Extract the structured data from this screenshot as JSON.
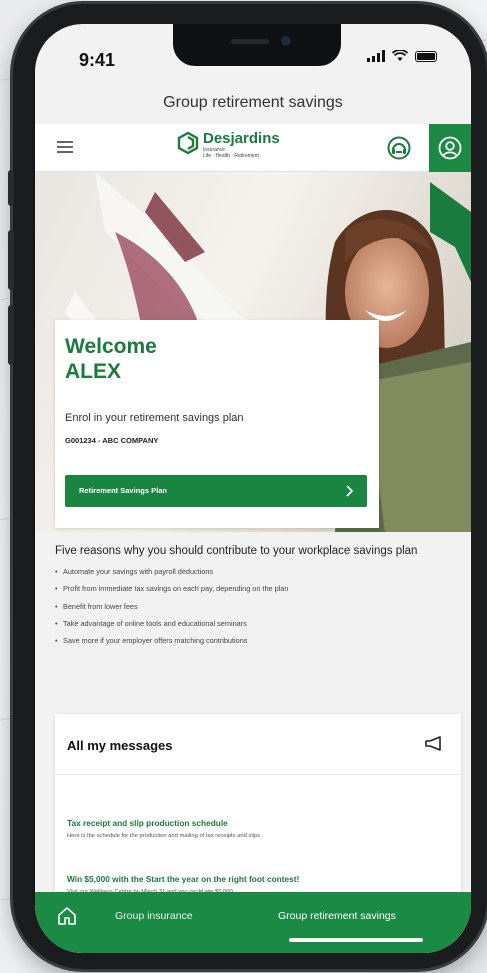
{
  "status_bar": {
    "time": "9:41"
  },
  "page": {
    "title": "Group retirement savings"
  },
  "header": {
    "brand_name": "Desjardins",
    "brand_sub_1": "Insurance",
    "brand_sub_2": "Life · Health · Retirement",
    "menu_icon": "hamburger-icon",
    "help_icon": "support-icon",
    "user_icon": "user-icon"
  },
  "welcome": {
    "greeting": "Welcome",
    "name": "ALEX",
    "enrol_text": "Enrol in your retirement savings plan",
    "company": "G001234 - ABC COMPANY",
    "plan_button": "Retirement Savings Plan"
  },
  "reasons": {
    "title": "Five reasons why you should contribute to your workplace savings plan",
    "items": [
      "Automate your savings with payroll deductions",
      "Profit from immediate tax savings on each pay, depending on the plan",
      "Benefit from lower fees",
      "Take advantage of online tools and educational seminars",
      "Save more if your employer offers matching contributions"
    ]
  },
  "messages": {
    "heading": "All my messages",
    "items": [
      {
        "title": "Tax receipt and slip production schedule",
        "desc": "Here is the schedule for the production and mailing of tax receipts and slips."
      },
      {
        "title": "Win $5,000 with the Start the year on the right foot contest!",
        "desc": "Visit our Wellness Centre by March 31 and you could win $5,000."
      }
    ]
  },
  "bottom_nav": {
    "insurance": "Group insurance",
    "retirement": "Group retirement savings"
  },
  "colors": {
    "brand_green": "#1b8a44",
    "text_green": "#1b7b3e"
  }
}
